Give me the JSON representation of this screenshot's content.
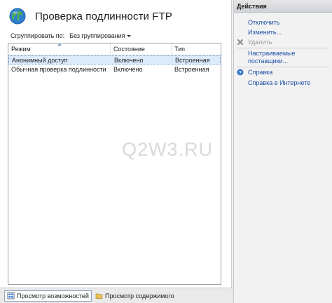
{
  "page": {
    "title": "Проверка подлинности FTP"
  },
  "grouping": {
    "label": "Сгруппировать по:",
    "value": "Без группирования"
  },
  "table": {
    "columns": [
      "Режим",
      "Состояние",
      "Тип"
    ],
    "rows": [
      {
        "mode": "Анонимный доступ",
        "state": "Включено",
        "type": "Встроенная"
      },
      {
        "mode": "Обычная проверка подлинности",
        "state": "Включено",
        "type": "Встроенная"
      }
    ]
  },
  "watermark": "Q2W3.RU",
  "actions": {
    "header": "Действия",
    "disable": "Отключить",
    "edit": "Изменить...",
    "remove": "Удалить",
    "providers_line1": "Настраиваемые",
    "providers_line2": "поставщики...",
    "help": "Справка",
    "online_help": "Справка в Интернете"
  },
  "tabs": {
    "features_view": "Просмотр возможностей",
    "content_view": "Просмотр содержимого"
  },
  "colors": {
    "link": "#1a4ea8",
    "selection": "#dcebfc",
    "disabled": "#9a9a9a"
  }
}
